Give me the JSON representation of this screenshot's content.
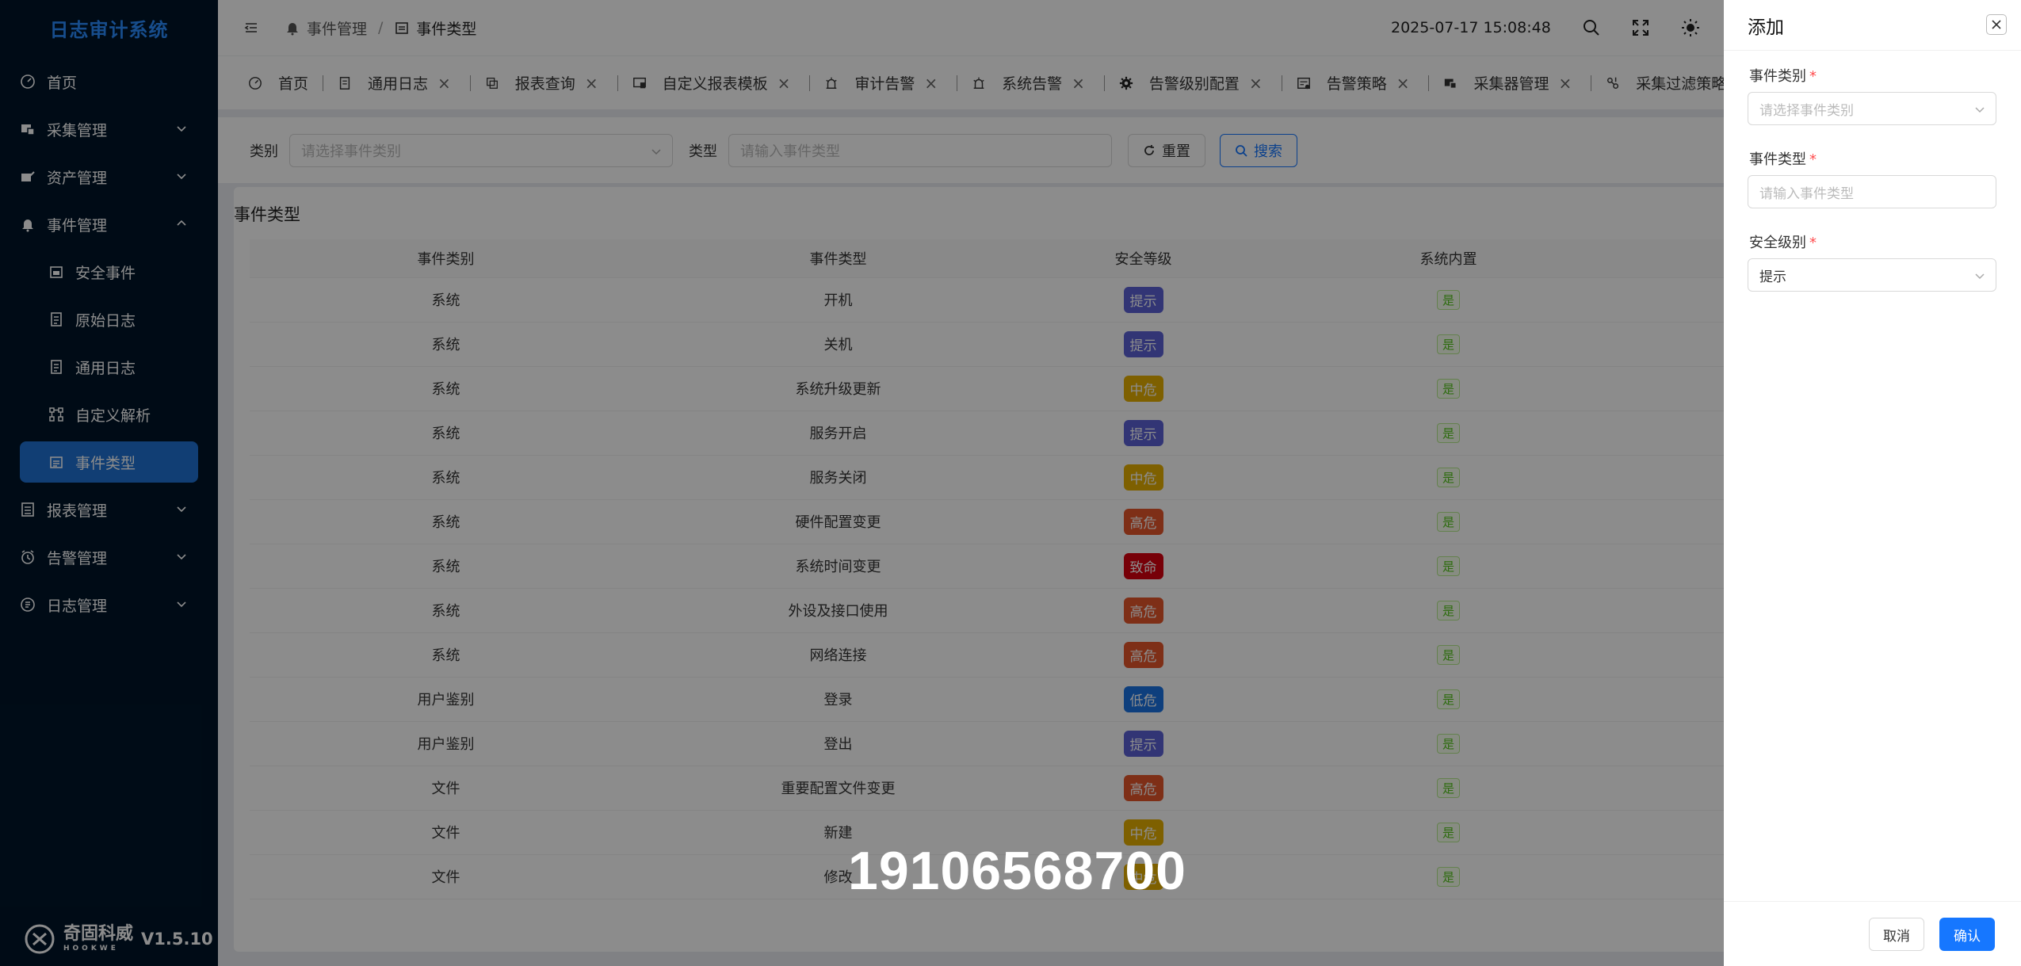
{
  "app": {
    "title": "日志审计系统",
    "version": "V1.5.10",
    "brand": "奇固科威",
    "brand_sub": "HOOKWE"
  },
  "sidebar": {
    "items": [
      {
        "label": "首页",
        "icon": "dashboard-icon"
      },
      {
        "label": "采集管理",
        "icon": "collect-icon"
      },
      {
        "label": "资产管理",
        "icon": "asset-icon"
      },
      {
        "label": "事件管理",
        "icon": "bell-icon"
      },
      {
        "label": "安全事件",
        "icon": "calendar-icon"
      },
      {
        "label": "原始日志",
        "icon": "log-icon"
      },
      {
        "label": "通用日志",
        "icon": "log-icon"
      },
      {
        "label": "自定义解析",
        "icon": "parse-icon"
      },
      {
        "label": "事件类型",
        "icon": "calendar-icon"
      },
      {
        "label": "报表管理",
        "icon": "report-icon"
      },
      {
        "label": "告警管理",
        "icon": "alarm-icon"
      },
      {
        "label": "日志管理",
        "icon": "log-manage-icon"
      }
    ]
  },
  "header": {
    "breadcrumb": [
      "事件管理",
      "事件类型"
    ],
    "datetime": "2025-07-17 15:08:48"
  },
  "tabs": [
    {
      "label": "首页"
    },
    {
      "label": "通用日志"
    },
    {
      "label": "报表查询"
    },
    {
      "label": "自定义报表模板"
    },
    {
      "label": "审计告警"
    },
    {
      "label": "系统告警"
    },
    {
      "label": "告警级别配置"
    },
    {
      "label": "告警策略"
    },
    {
      "label": "采集器管理"
    },
    {
      "label": "采集过滤策略"
    }
  ],
  "filter": {
    "category_label": "类别",
    "category_placeholder": "请选择事件类别",
    "type_label": "类型",
    "type_placeholder": "请输入事件类型",
    "reset_label": "重置",
    "search_label": "搜索"
  },
  "card": {
    "title": "事件类型"
  },
  "table": {
    "headers": [
      "事件类别",
      "事件类型",
      "安全等级",
      "系统内置"
    ],
    "rows": [
      {
        "category": "系统",
        "type": "开机",
        "level": "提示",
        "builtin": "是"
      },
      {
        "category": "系统",
        "type": "关机",
        "level": "提示",
        "builtin": "是"
      },
      {
        "category": "系统",
        "type": "系统升级更新",
        "level": "中危",
        "builtin": "是"
      },
      {
        "category": "系统",
        "type": "服务开启",
        "level": "提示",
        "builtin": "是"
      },
      {
        "category": "系统",
        "type": "服务关闭",
        "level": "中危",
        "builtin": "是"
      },
      {
        "category": "系统",
        "type": "硬件配置变更",
        "level": "高危",
        "builtin": "是"
      },
      {
        "category": "系统",
        "type": "系统时间变更",
        "level": "致命",
        "builtin": "是"
      },
      {
        "category": "系统",
        "type": "外设及接口使用",
        "level": "高危",
        "builtin": "是"
      },
      {
        "category": "系统",
        "type": "网络连接",
        "level": "高危",
        "builtin": "是"
      },
      {
        "category": "用户鉴别",
        "type": "登录",
        "level": "低危",
        "builtin": "是"
      },
      {
        "category": "用户鉴别",
        "type": "登出",
        "level": "提示",
        "builtin": "是"
      },
      {
        "category": "文件",
        "type": "重要配置文件变更",
        "level": "高危",
        "builtin": "是"
      },
      {
        "category": "文件",
        "type": "新建",
        "level": "中危",
        "builtin": "是"
      },
      {
        "category": "文件",
        "type": "修改",
        "level": "中危",
        "builtin": "是"
      }
    ]
  },
  "level_colors": {
    "提示": "#5b62d6",
    "中危": "#e6b000",
    "高危": "#e5562a",
    "致命": "#d9000f",
    "低危": "#1b74e4"
  },
  "watermark": "19106568700",
  "drawer": {
    "title": "添加",
    "category_label": "事件类别",
    "category_placeholder": "请选择事件类别",
    "type_label": "事件类型",
    "type_placeholder": "请输入事件类型",
    "level_label": "安全级别",
    "level_value": "提示",
    "cancel_label": "取消",
    "confirm_label": "确认"
  }
}
